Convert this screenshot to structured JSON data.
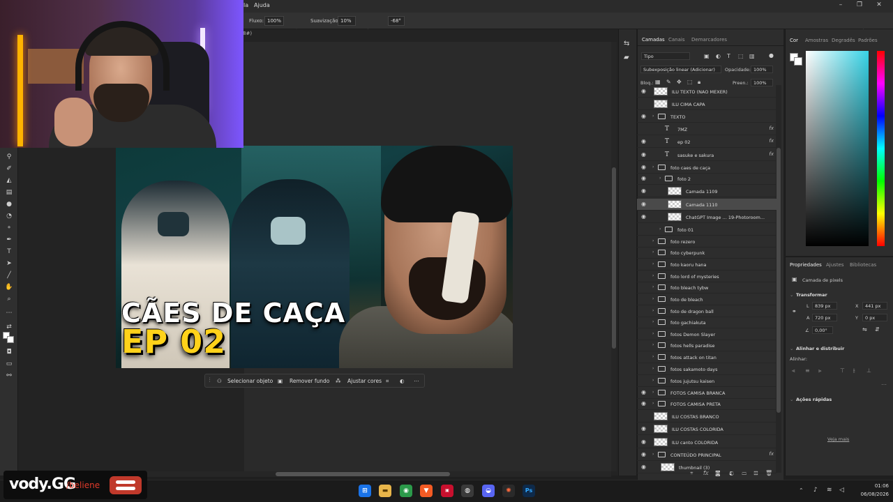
{
  "menu": {
    "item_a": "la",
    "item_b": "Ajuda"
  },
  "options": {
    "flow_label": "Fluxo:",
    "flow_value": "100%",
    "smooth_label": "Suavização:",
    "smooth_value": "10%",
    "angle_value": "-68°"
  },
  "doc_tab": "8#)",
  "thumbnail": {
    "title": "CÃES DE CAÇA",
    "subtitle": "EP 02"
  },
  "task_bar": {
    "select_subject": "Selecionar objeto",
    "remove_bg": "Remover fundo",
    "adjust_colors": "Ajustar cores"
  },
  "layers_panel": {
    "tabs": [
      "Camadas",
      "Canais",
      "Demarcadores"
    ],
    "filter": "Tipo",
    "blend_mode": "Subexposição linear (Adicionar)",
    "opacity_label": "Opacidade:",
    "opacity_value": "100%",
    "lock_label": "Bloq.:",
    "fill_label": "Preen.:",
    "fill_value": "100%",
    "layers": [
      {
        "name": "ILU TEXTO (NAO MEXER)",
        "kind": "pixel",
        "visible": true
      },
      {
        "name": "ILU CIMA CAPA",
        "kind": "pixel",
        "visible": false
      },
      {
        "name": "TEXTO",
        "kind": "group",
        "visible": true
      },
      {
        "name": "7MZ",
        "kind": "text",
        "visible": false,
        "fx": "fx"
      },
      {
        "name": "ep 02",
        "kind": "text",
        "visible": true,
        "fx": "fx"
      },
      {
        "name": "sasuke e sakura",
        "kind": "text",
        "visible": true,
        "fx": "fx"
      },
      {
        "name": "foto caes de caça",
        "kind": "group",
        "visible": true
      },
      {
        "name": "foto 2",
        "kind": "group",
        "visible": true
      },
      {
        "name": "Camada 1109",
        "kind": "pixel",
        "visible": true
      },
      {
        "name": "Camada 1110",
        "kind": "pixel",
        "visible": true
      },
      {
        "name": "ChatGPT Image ... 19-Photoroom...",
        "kind": "pixel",
        "visible": true
      },
      {
        "name": "foto 01",
        "kind": "group",
        "visible": false
      },
      {
        "name": "foto rezero",
        "kind": "group",
        "visible": false
      },
      {
        "name": "foto cyberpunk",
        "kind": "group",
        "visible": false
      },
      {
        "name": "foto kaoru hana",
        "kind": "group",
        "visible": false
      },
      {
        "name": "foto lord of mysteries",
        "kind": "group",
        "visible": false
      },
      {
        "name": "foto bleach tybw",
        "kind": "group",
        "visible": false
      },
      {
        "name": "foto de bleach",
        "kind": "group",
        "visible": false
      },
      {
        "name": "foto de dragon ball",
        "kind": "group",
        "visible": false
      },
      {
        "name": "foto gachiakuta",
        "kind": "group",
        "visible": false
      },
      {
        "name": "fotos Demon Slayer",
        "kind": "group",
        "visible": false
      },
      {
        "name": "fotos hells paradise",
        "kind": "group",
        "visible": false
      },
      {
        "name": "fotos attack on titan",
        "kind": "group",
        "visible": false
      },
      {
        "name": "fotos sakamoto days",
        "kind": "group",
        "visible": false
      },
      {
        "name": "fotos jujutsu kaisen",
        "kind": "group",
        "visible": false
      },
      {
        "name": "FOTOS CAMISA BRANCA",
        "kind": "group",
        "visible": true
      },
      {
        "name": "FOTOS CAMISA PRETA",
        "kind": "group",
        "visible": true
      },
      {
        "name": "ILU COSTAS BRANCO",
        "kind": "pixel",
        "visible": false
      },
      {
        "name": "ILU COSTAS COLORIDA",
        "kind": "pixel",
        "visible": true
      },
      {
        "name": "ILU canto COLORIDA",
        "kind": "pixel",
        "visible": true
      },
      {
        "name": "CONTEÚDO PRINCIPAL",
        "kind": "group",
        "visible": true,
        "fx": "fx"
      },
      {
        "name": "thumbnail (3)",
        "kind": "pixel",
        "visible": true
      }
    ]
  },
  "color_panel": {
    "tabs": [
      "Cor",
      "Amostras",
      "Degradês",
      "Padrões"
    ]
  },
  "props_panel": {
    "tabs": [
      "Propriedades",
      "Ajustes",
      "Bibliotecas"
    ],
    "layer_type": "Camada de pixels",
    "transform_title": "Transformar",
    "L_label": "L",
    "L_value": "839 px",
    "A_label": "A",
    "A_value": "720 px",
    "X_label": "X",
    "X_value": "441 px",
    "Y_label": "Y",
    "Y_value": "0 px",
    "angle_value": "0,00°",
    "align_title": "Alinhar e distribuir",
    "align_label": "Alinhar:",
    "quick_title": "Ações rápidas",
    "see_more": "Veja mais"
  },
  "brand_overlay": {
    "name": "vody.GG",
    "sub": "/beliene"
  },
  "clock": {
    "time": "01:06",
    "date": "06/08/2026"
  }
}
